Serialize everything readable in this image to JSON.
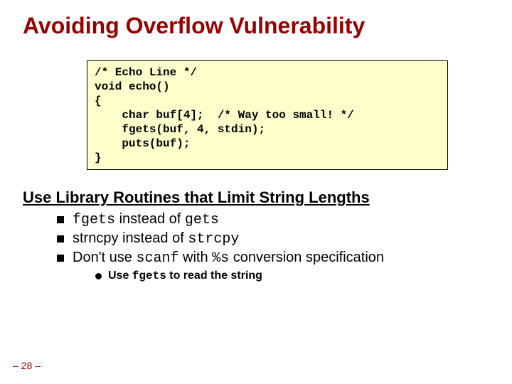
{
  "title": "Avoiding Overflow Vulnerability",
  "code": {
    "l1": "/* Echo Line */",
    "l2": "void echo()",
    "l3": "{",
    "l4": "    char buf[4];  /* Way too small! */",
    "l5": "    fgets(buf, 4, stdin);",
    "l6": "    puts(buf);",
    "l7": "}"
  },
  "subhead": "Use Library Routines that Limit String Lengths",
  "bullets": {
    "b1": {
      "mono_a": "fgets",
      "text_a": " instead of ",
      "mono_b": "gets"
    },
    "b2": {
      "text_a": "strncpy instead of ",
      "mono_a": "strcpy"
    },
    "b3": {
      "text_a": "Don't use ",
      "mono_a": "scanf",
      "text_b": " with ",
      "mono_b": "%s",
      "text_c": " conversion specification"
    },
    "sub1": {
      "text_a": "Use ",
      "mono_a": "fgets",
      "text_b": " to read the string"
    }
  },
  "page": "– 28 –"
}
